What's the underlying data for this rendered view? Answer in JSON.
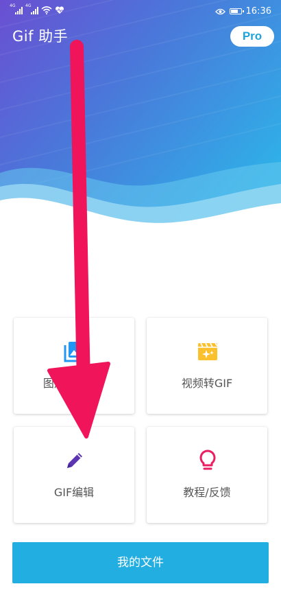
{
  "status_bar": {
    "sim1_net": "4G",
    "sim2_net": "4G",
    "time": "16:36"
  },
  "app_title": "Gif 助手",
  "pro_label": "Pro",
  "cards": [
    {
      "label": "图片合成GIF",
      "icon": "image-stack-icon"
    },
    {
      "label": "视频转GIF",
      "icon": "clapperboard-sparkle-icon"
    },
    {
      "label": "GIF编辑",
      "icon": "pencil-icon"
    },
    {
      "label": "教程/反馈",
      "icon": "lightbulb-icon"
    }
  ],
  "files_button_label": "我的文件",
  "colors": {
    "hero_purple": "#6c4fd1",
    "hero_blue": "#2fa9e8",
    "accent_blue": "#22aee1",
    "icon_blue": "#2196f3",
    "icon_yellow": "#fbc02d",
    "icon_purple": "#5e35b1",
    "icon_red": "#e91e63",
    "arrow": "#f0145a"
  }
}
